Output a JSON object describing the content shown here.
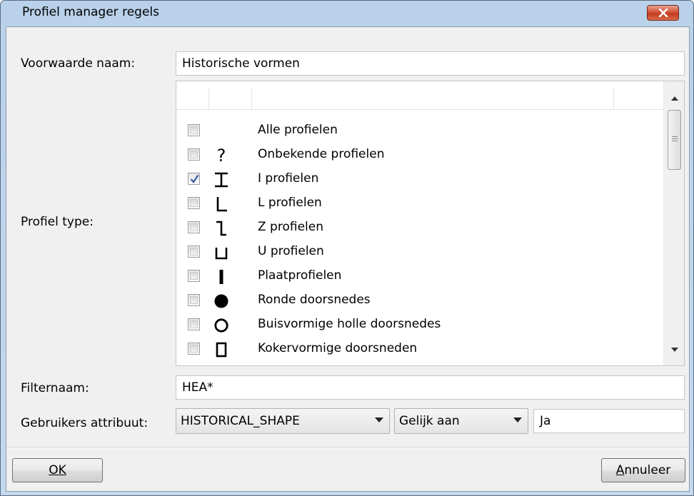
{
  "window": {
    "title": "Profiel manager regels"
  },
  "form": {
    "condition_name_label": "Voorwaarde naam:",
    "condition_name_value": "Historische vormen",
    "profile_type_label": "Profiel type:",
    "filter_name_label": "Filternaam:",
    "filter_name_value": "HEA*",
    "user_attribute_label": "Gebruikers attribuut:",
    "user_attribute_value": "HISTORICAL_SHAPE",
    "operator_value": "Gelijk aan",
    "attribute_value": "Ja"
  },
  "profile_types": [
    {
      "label": "Alle profielen",
      "checked": false,
      "icon": "none"
    },
    {
      "label": "Onbekende profielen",
      "checked": false,
      "icon": "question-mark-icon"
    },
    {
      "label": "I profielen",
      "checked": true,
      "icon": "i-beam-icon"
    },
    {
      "label": "L profielen",
      "checked": false,
      "icon": "l-angle-icon"
    },
    {
      "label": "Z profielen",
      "checked": false,
      "icon": "z-profile-icon"
    },
    {
      "label": "U profielen",
      "checked": false,
      "icon": "u-channel-icon"
    },
    {
      "label": "Plaatprofielen",
      "checked": false,
      "icon": "plate-icon"
    },
    {
      "label": "Ronde doorsnedes",
      "checked": false,
      "icon": "solid-circle-icon"
    },
    {
      "label": "Buisvormige holle doorsnedes",
      "checked": false,
      "icon": "hollow-circle-icon"
    },
    {
      "label": "Kokervormige doorsneden",
      "checked": false,
      "icon": "hollow-rectangle-icon"
    }
  ],
  "buttons": {
    "ok_label": "OK",
    "cancel_label": "Annuleer"
  }
}
